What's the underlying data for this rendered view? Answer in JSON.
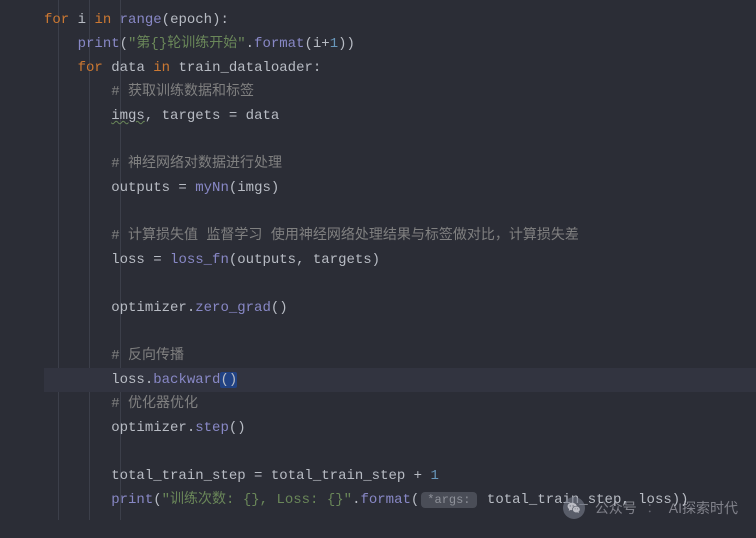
{
  "code": {
    "l1": {
      "for": "for",
      "var": "i",
      "in": "in",
      "range": "range",
      "epoch": "epoch",
      "close": "):"
    },
    "l2": {
      "print": "print",
      "open": "(",
      "str": "\"第{}轮训练开始\"",
      "dot": ".",
      "format": "format",
      "args_open": "(",
      "arg1": "i",
      "plus": "+",
      "one": "1",
      "close": "))"
    },
    "l3": {
      "for": "for",
      "var": "data",
      "in": "in",
      "loader": "train_dataloader",
      "colon": ":"
    },
    "l4": {
      "comment": "# 获取训练数据和标签"
    },
    "l5": {
      "imgs": "imgs",
      "sep": ", ",
      "targets": "targets",
      "eq": " = ",
      "data": "data"
    },
    "l6": {
      "blank": ""
    },
    "l7": {
      "comment": "# 神经网络对数据进行处理"
    },
    "l8": {
      "outputs": "outputs",
      "eq": " = ",
      "fn": "myNn",
      "args": "(imgs)"
    },
    "l9": {
      "blank": ""
    },
    "l10": {
      "comment": "# 计算损失值 监督学习 使用神经网络处理结果与标签做对比，计算损失差"
    },
    "l11": {
      "loss": "loss",
      "eq": " = ",
      "fn": "loss_fn",
      "args": "(outputs, targets)"
    },
    "l12": {
      "blank": ""
    },
    "l13": {
      "opt": "optimizer",
      "dot": ".",
      "fn": "zero_grad",
      "args": "()"
    },
    "l14": {
      "blank": ""
    },
    "l15": {
      "comment": "# 反向传播"
    },
    "l16": {
      "loss": "loss",
      "dot": ".",
      "fn": "backward",
      "args": "()"
    },
    "l17": {
      "comment": "# 优化器优化"
    },
    "l18": {
      "opt": "optimizer",
      "dot": ".",
      "fn": "step",
      "args": "()"
    },
    "l19": {
      "blank": ""
    },
    "l20": {
      "var": "total_train_step",
      "eq": " = ",
      "rhs": "total_train_step",
      "plus": " + ",
      "one": "1"
    },
    "l21": {
      "print": "print",
      "open": "(",
      "str": "\"训练次数: {}, Loss: {}\"",
      "dot": ".",
      "format": "format",
      "args_open": "(",
      "hint": "*args:",
      "rest": " total_train_step, loss))"
    }
  },
  "watermark": {
    "label1": "公众号",
    "sep": "：",
    "label2": "AI探索时代"
  }
}
